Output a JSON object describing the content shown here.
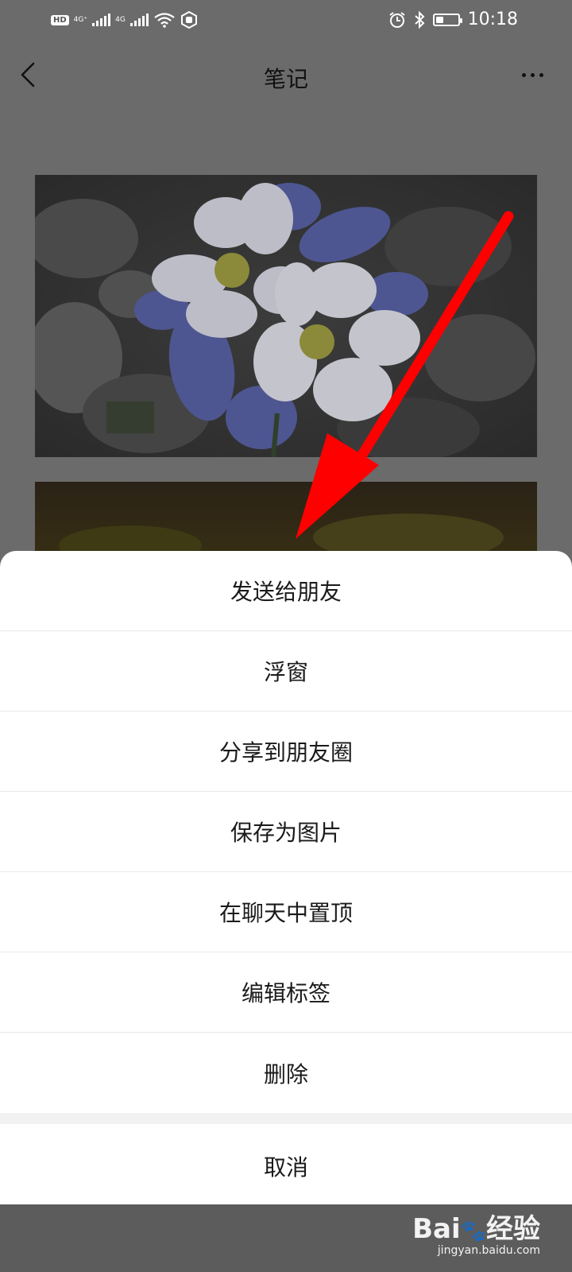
{
  "status_bar": {
    "hd": "HD",
    "net1": "4G⁺",
    "net2": "4G",
    "time": "10:18",
    "battery_level": 0.35
  },
  "header": {
    "title": "笔记"
  },
  "action_sheet": {
    "items": [
      {
        "label": "发送给朋友"
      },
      {
        "label": "浮窗"
      },
      {
        "label": "分享到朋友圈"
      },
      {
        "label": "保存为图片"
      },
      {
        "label": "在聊天中置顶"
      },
      {
        "label": "编辑标签"
      },
      {
        "label": "删除"
      }
    ],
    "cancel": "取消"
  },
  "watermark": {
    "brand": "Bai",
    "brand_suffix": "经验",
    "url": "jingyan.baidu.com"
  },
  "colors": {
    "overlay": "#6b6b6b",
    "arrow": "#ff0000",
    "sheet_bg": "#ffffff"
  }
}
